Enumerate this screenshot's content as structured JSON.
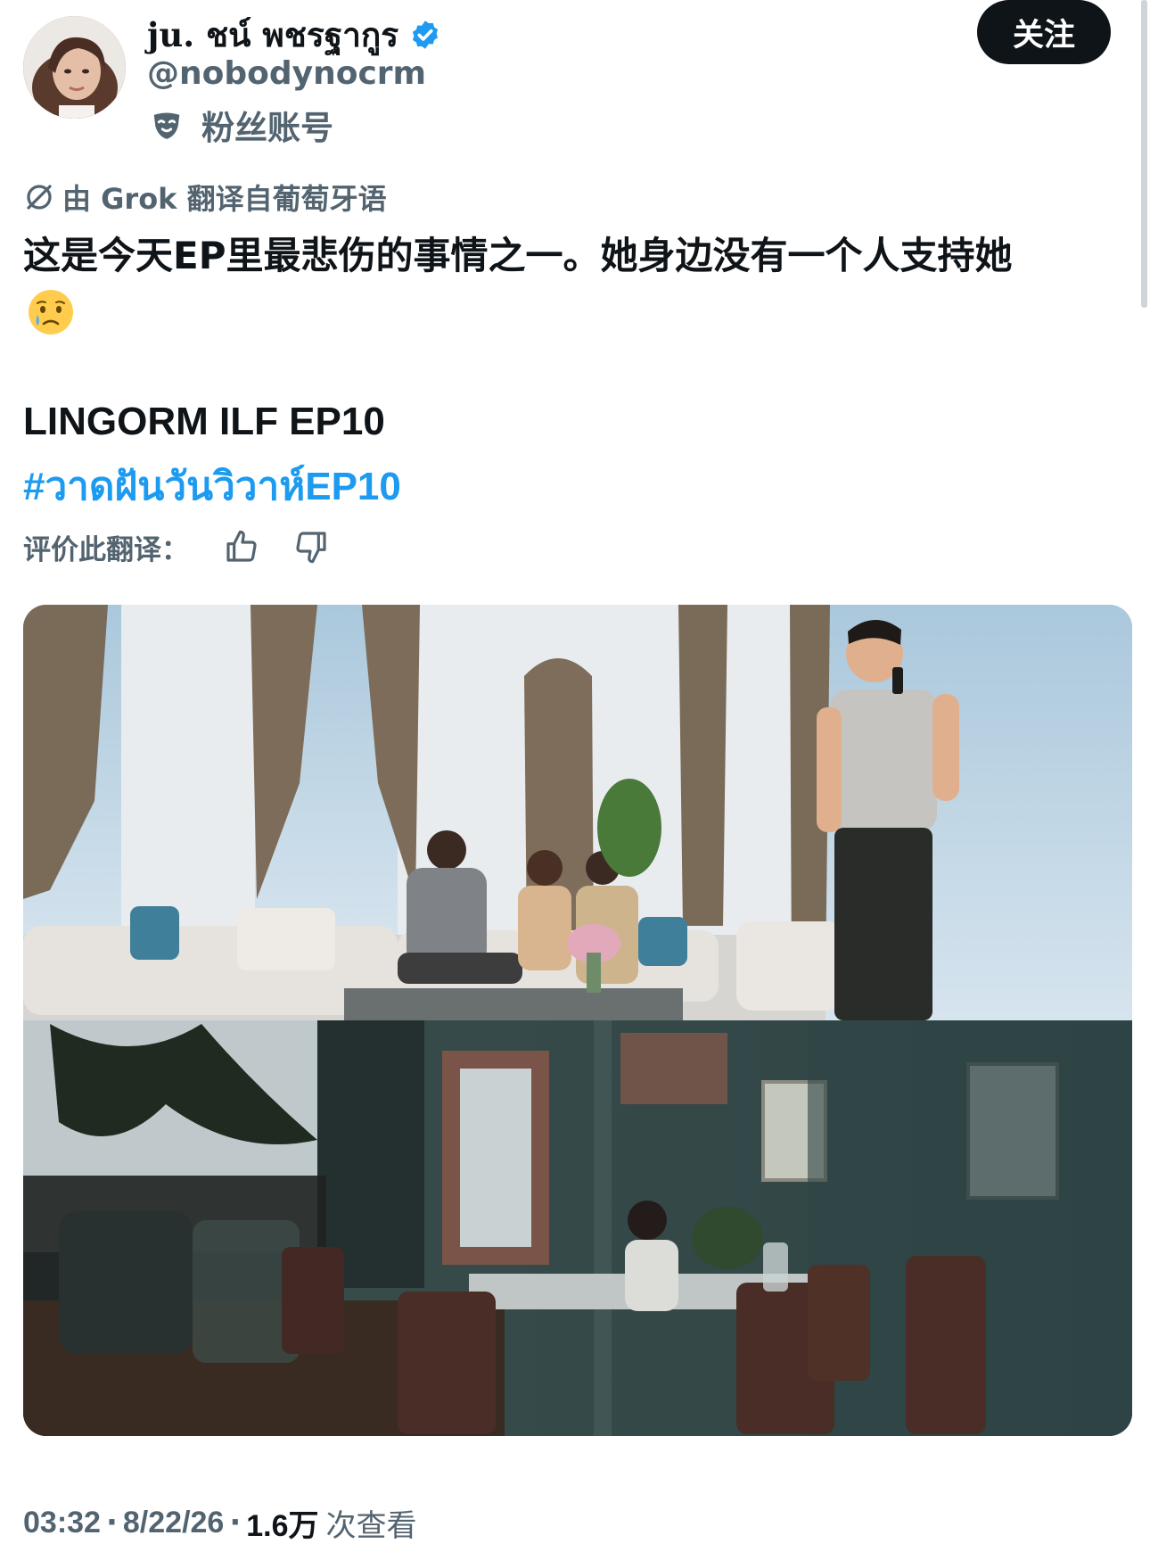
{
  "author": {
    "display_name": "ju. ชน์ พชรฐากูร",
    "handle": "@nobodynocrm",
    "fan_account_label": "粉丝账号",
    "verified": true
  },
  "follow_button": {
    "label": "关注"
  },
  "translation": {
    "note": "由 Grok 翻译自葡萄牙语",
    "rate_label": "评价此翻译："
  },
  "tweet": {
    "text": "这是今天EP里最悲伤的事情之一。她身边没有一个人支持她",
    "emoji": "crying-face",
    "title": "LINGORM ILF EP10",
    "hashtag": "#วาดฝันวันวิวาห์EP10"
  },
  "meta": {
    "time": "03:32",
    "date": "8/22/26",
    "views": "1.6万",
    "views_label": "次查看",
    "separator": "·"
  },
  "colors": {
    "text": "#0f1419",
    "secondary": "#536471",
    "link": "#1d9bf0",
    "button_bg": "#0f1419"
  }
}
